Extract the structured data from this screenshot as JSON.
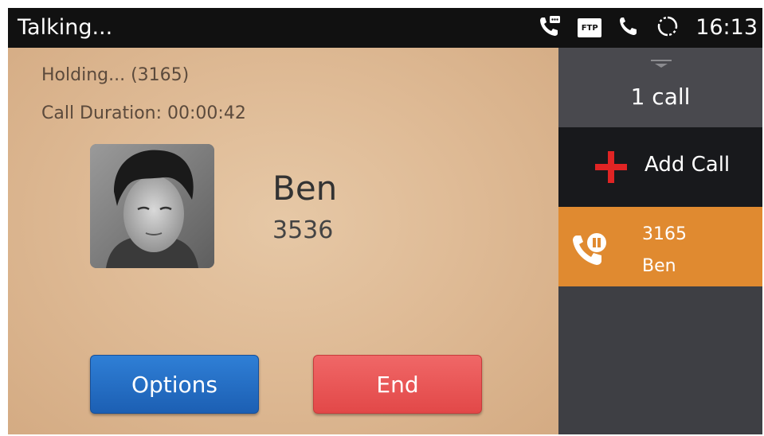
{
  "status_bar": {
    "title": "Talking...",
    "time": "16:13",
    "ftp_badge": "FTP",
    "icons": [
      "voicemail-phone-icon",
      "ftp-icon",
      "phone-icon",
      "sync-icon"
    ]
  },
  "call": {
    "hold_status": "Holding... (3165)",
    "duration": "Call Duration: 00:00:42",
    "contact_name": "Ben",
    "contact_number": "3536",
    "options_label": "Options",
    "end_label": "End"
  },
  "sidebar": {
    "call_count": "1 call",
    "add_call_label": "Add Call",
    "calls": [
      {
        "number": "3165",
        "name": "Ben",
        "state_icon": "held-call-icon"
      }
    ]
  },
  "colors": {
    "status_bar": "#111111",
    "panel": "#dfbb96",
    "options_button": "#2a74cc",
    "end_button": "#ea5656",
    "sidebar": "#3e3f44",
    "add_call_bg": "#18191c",
    "held_call_bg": "#e08a30",
    "plus_icon": "#e02424"
  }
}
